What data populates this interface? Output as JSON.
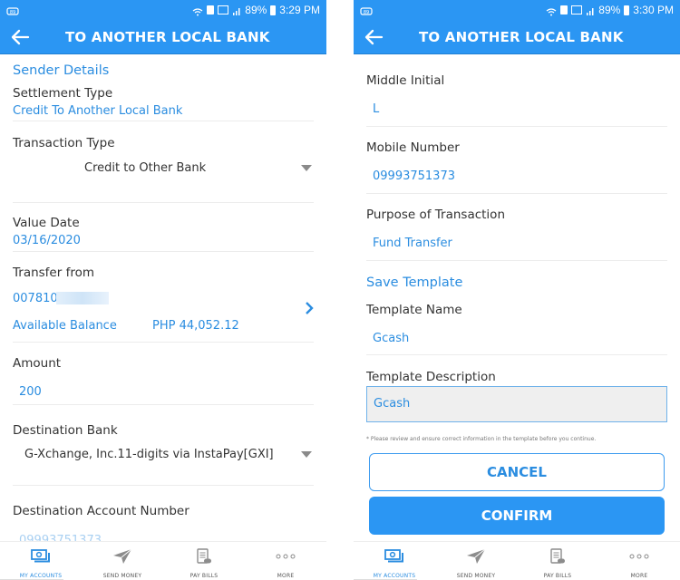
{
  "screens": [
    {
      "status_bar": {
        "battery": "89%",
        "time": "3:29 PM"
      },
      "app_bar": {
        "title": "TO ANOTHER LOCAL BANK"
      },
      "sender_details_heading": "Sender Details",
      "fields": {
        "settlement_type": {
          "label": "Settlement Type",
          "value": "Credit To Another Local Bank"
        },
        "transaction_type": {
          "label": "Transaction Type",
          "value": "Credit to Other Bank"
        },
        "value_date": {
          "label": "Value Date",
          "value": "03/16/2020"
        },
        "transfer_from": {
          "label": "Transfer from",
          "account": "007810",
          "balance_label": "Available Balance",
          "balance_value": "PHP 44,052.12"
        },
        "amount": {
          "label": "Amount",
          "value": "200"
        },
        "destination_bank": {
          "label": "Destination Bank",
          "value": "G-Xchange, Inc.11-digits via InstaPay[GXI]"
        },
        "destination_account_number": {
          "label": "Destination Account Number",
          "value": "09993751373"
        }
      }
    },
    {
      "status_bar": {
        "battery": "89%",
        "time": "3:30 PM"
      },
      "app_bar": {
        "title": "TO ANOTHER LOCAL BANK"
      },
      "fields": {
        "middle_initial": {
          "label": "Middle Initial",
          "value": "L"
        },
        "mobile_number": {
          "label": "Mobile Number",
          "value": "09993751373"
        },
        "purpose": {
          "label": "Purpose of Transaction",
          "value": "Fund Transfer"
        }
      },
      "save_template_heading": "Save Template",
      "template_name": {
        "label": "Template Name",
        "value": "Gcash"
      },
      "template_description": {
        "label": "Template Description",
        "value": "Gcash"
      },
      "note": "* Please review and ensure correct information in the template before you continue.",
      "buttons": {
        "cancel": "CANCEL",
        "confirm": "CONFIRM"
      }
    }
  ],
  "bottom_nav": [
    {
      "label": "MY ACCOUNTS",
      "icon": "accounts-icon",
      "active": true
    },
    {
      "label": "SEND MONEY",
      "icon": "paper-plane-icon",
      "active": false
    },
    {
      "label": "PAY BILLS",
      "icon": "bill-icon",
      "active": false
    },
    {
      "label": "MORE",
      "icon": "more-dots-icon",
      "active": false
    }
  ],
  "colors": {
    "primary": "#2b96f3",
    "accent_text": "#2b8de0",
    "label_text": "#333333"
  }
}
